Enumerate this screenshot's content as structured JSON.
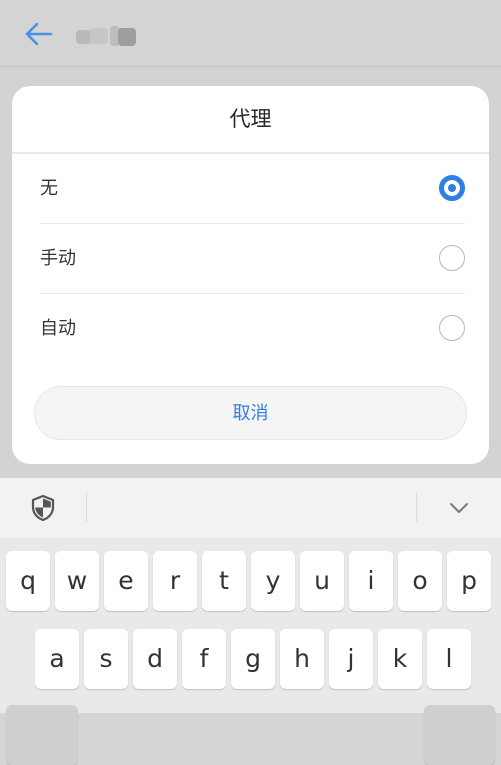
{
  "dialog": {
    "title": "代理",
    "options": [
      {
        "label": "无",
        "selected": true
      },
      {
        "label": "手动",
        "selected": false
      },
      {
        "label": "自动",
        "selected": false
      }
    ],
    "cancel_label": "取消"
  },
  "icons": {
    "back": "arrow-left-icon",
    "shield": "shield-icon",
    "collapse": "chevron-down-icon"
  },
  "keyboard": {
    "row1": [
      "q",
      "w",
      "e",
      "r",
      "t",
      "y",
      "u",
      "i",
      "o",
      "p"
    ],
    "row2": [
      "a",
      "s",
      "d",
      "f",
      "g",
      "h",
      "j",
      "k",
      "l"
    ]
  },
  "colors": {
    "accent": "#2f7ee8",
    "dialog_bg": "#ffffff",
    "scrim": "#d4d4d4"
  }
}
